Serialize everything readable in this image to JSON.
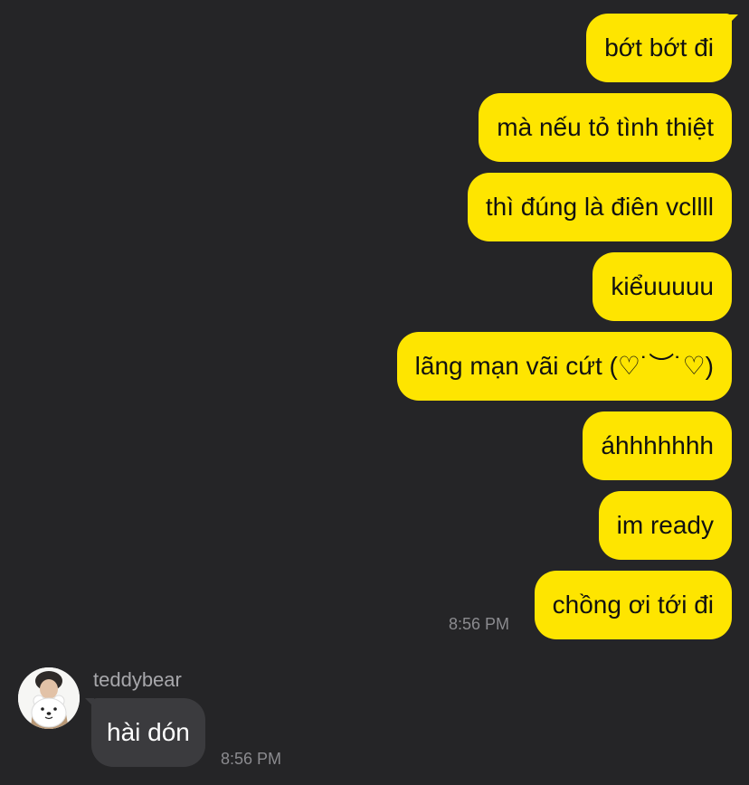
{
  "conversation": {
    "outgoing": [
      {
        "text": "bớt bớt đi"
      },
      {
        "text": "mà nếu tỏ tình thiệt"
      },
      {
        "text": "thì đúng là điên vcllll"
      },
      {
        "text": "kiểuuuuu"
      },
      {
        "text": "lãng mạn vãi cứt (♡˙︶˙♡)"
      },
      {
        "text": "áhhhhhhh"
      },
      {
        "text": "im ready"
      },
      {
        "text": "chồng ơi tới đi"
      }
    ],
    "outgoing_time": "8:56 PM",
    "incoming": {
      "sender": "teddybear",
      "avatar_icon": "profile-photo-with-teddy-bear",
      "text": "hài dón",
      "time": "8:56 PM"
    }
  },
  "colors": {
    "background": "#252527",
    "outgoing_bubble": "#fee500",
    "incoming_bubble": "#3b3b3e",
    "timestamp": "#8b8b8f"
  }
}
